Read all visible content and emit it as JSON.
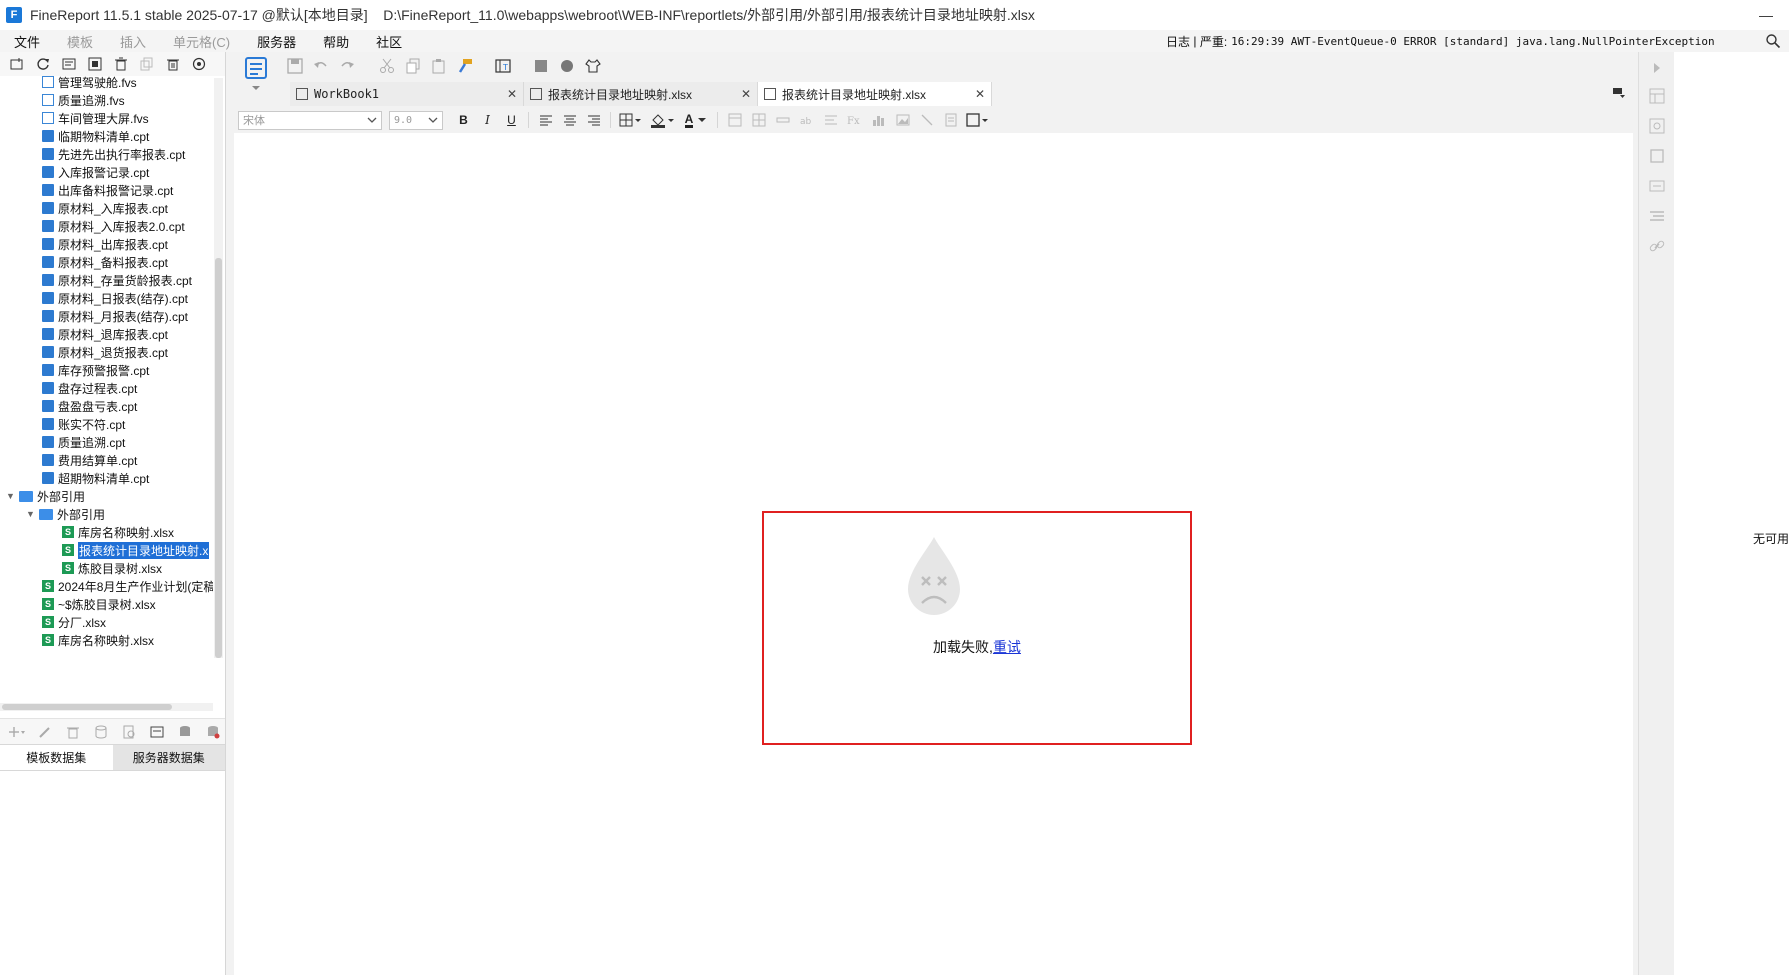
{
  "window": {
    "title_app": "FineReport 11.5.1 stable 2025-07-17 @默认[本地目录]",
    "title_path": "D:\\FineReport_11.0\\webapps\\webroot\\WEB-INF\\reportlets/外部引用/外部引用/报表统计目录地址映射.xlsx"
  },
  "menu": {
    "items": [
      {
        "label": "文件",
        "enabled": true
      },
      {
        "label": "模板",
        "enabled": false
      },
      {
        "label": "插入",
        "enabled": false
      },
      {
        "label": "单元格(C)",
        "enabled": false
      },
      {
        "label": "服务器",
        "enabled": true
      },
      {
        "label": "帮助",
        "enabled": true
      },
      {
        "label": "社区",
        "enabled": true
      }
    ],
    "log_label": "日志",
    "log_level": "严重:",
    "log_message": "16:29:39 AWT-EventQueue-0 ERROR [standard] java.lang.NullPointerException"
  },
  "tree": {
    "rows": [
      {
        "label": "管理驾驶舱.fvs",
        "type": "fvs"
      },
      {
        "label": "质量追溯.fvs",
        "type": "fvs"
      },
      {
        "label": "车间管理大屏.fvs",
        "type": "fvs"
      },
      {
        "label": "临期物料清单.cpt",
        "type": "cpt"
      },
      {
        "label": "先进先出执行率报表.cpt",
        "type": "cpt"
      },
      {
        "label": "入库报警记录.cpt",
        "type": "cpt"
      },
      {
        "label": "出库备料报警记录.cpt",
        "type": "cpt"
      },
      {
        "label": "原材料_入库报表.cpt",
        "type": "cpt"
      },
      {
        "label": "原材料_入库报表2.0.cpt",
        "type": "cpt"
      },
      {
        "label": "原材料_出库报表.cpt",
        "type": "cpt"
      },
      {
        "label": "原材料_备料报表.cpt",
        "type": "cpt"
      },
      {
        "label": "原材料_存量货龄报表.cpt",
        "type": "cpt"
      },
      {
        "label": "原材料_日报表(结存).cpt",
        "type": "cpt"
      },
      {
        "label": "原材料_月报表(结存).cpt",
        "type": "cpt"
      },
      {
        "label": "原材料_退库报表.cpt",
        "type": "cpt"
      },
      {
        "label": "原材料_退货报表.cpt",
        "type": "cpt"
      },
      {
        "label": "库存预警报警.cpt",
        "type": "cpt"
      },
      {
        "label": "盘存过程表.cpt",
        "type": "cpt"
      },
      {
        "label": "盘盈盘亏表.cpt",
        "type": "cpt"
      },
      {
        "label": "账实不符.cpt",
        "type": "cpt"
      },
      {
        "label": "质量追溯.cpt",
        "type": "cpt"
      },
      {
        "label": "费用结算单.cpt",
        "type": "cpt"
      },
      {
        "label": "超期物料清单.cpt",
        "type": "cpt"
      },
      {
        "label": "外部引用",
        "type": "folder",
        "level": 0
      },
      {
        "label": "外部引用",
        "type": "folder",
        "level": 1
      },
      {
        "label": "库房名称映射.xlsx",
        "type": "xls",
        "level": 2
      },
      {
        "label": "报表统计目录地址映射.x",
        "type": "xls",
        "level": 2,
        "selected": true
      },
      {
        "label": "炼胶目录树.xlsx",
        "type": "xls",
        "level": 2
      },
      {
        "label": "2024年8月生产作业计划(定稿",
        "type": "xls"
      },
      {
        "label": "~$炼胶目录树.xlsx",
        "type": "xls"
      },
      {
        "label": "分厂.xlsx",
        "type": "xls"
      },
      {
        "label": "库房名称映射.xlsx",
        "type": "xls"
      }
    ]
  },
  "datasets": {
    "tab_template": "模板数据集",
    "tab_server": "服务器数据集"
  },
  "tabs": [
    {
      "label": "WorkBook1",
      "active": false
    },
    {
      "label": "报表统计目录地址映射.xlsx",
      "active": false
    },
    {
      "label": "报表统计目录地址映射.xlsx",
      "active": true
    }
  ],
  "format": {
    "font": "宋体",
    "size": "9.0",
    "bold": "B",
    "italic": "I",
    "underline": "U",
    "font_color_glyph": "A"
  },
  "error": {
    "message": "加载失败,",
    "retry": "重试"
  },
  "right_panel": {
    "message": "无可用"
  },
  "colors": {
    "accent": "#1f6fd6",
    "error_border": "#e02020",
    "link": "#1a35d6"
  }
}
